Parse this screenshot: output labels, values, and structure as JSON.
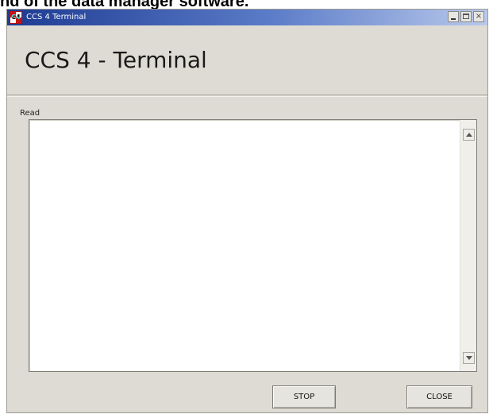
{
  "document": {
    "caption": "nd of the data manager software."
  },
  "window": {
    "title": "CCS 4 Terminal",
    "icon": "ccs-app-icon",
    "icon_glyph": "C4",
    "controls": {
      "minimize": "minimize",
      "maximize": "maximize",
      "close": "×"
    }
  },
  "header": {
    "title": "CCS 4 - Terminal"
  },
  "read": {
    "label": "Read",
    "content": ""
  },
  "buttons": {
    "stop": "STOP",
    "close": "CLOSE"
  },
  "colors": {
    "titlebar_start": "#1d3a92",
    "titlebar_end": "#b9c9ec",
    "window_bg": "#dedbd4",
    "textarea_bg": "#ffffff"
  }
}
